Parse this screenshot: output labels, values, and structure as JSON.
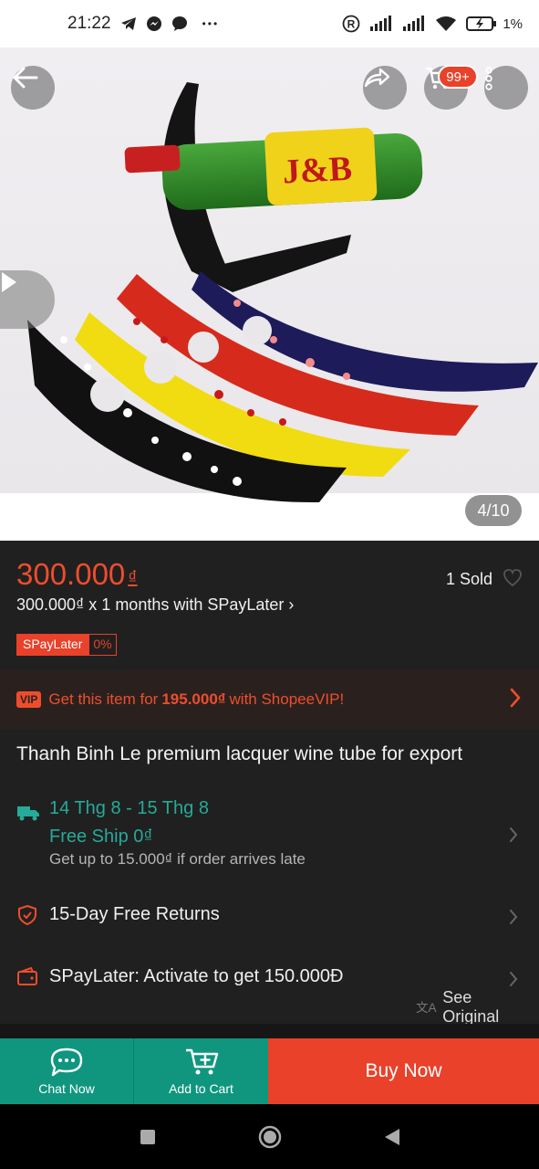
{
  "status_bar": {
    "time": "21:22",
    "more_dots": "•••",
    "battery_text": "1%"
  },
  "gallery": {
    "page_indicator": "4/10",
    "cart_badge": "99+"
  },
  "product": {
    "price": "300.000",
    "currency": "₫",
    "sold": "1 Sold",
    "installment": "300.000₫ x 1 months with SPayLater ›",
    "spay_badge_label": "SPayLater",
    "spay_badge_rate": "0%",
    "vip_tag": "VIP",
    "vip_text_prefix": "Get this item for",
    "vip_price": "195.000₫",
    "vip_text_suffix": "with ShopeeVIP!",
    "title": "Thanh Binh Le premium lacquer wine tube for export"
  },
  "shipping": {
    "dates": "14 Thg 8 - 15 Thg 8",
    "free_ship": "Free Ship 0₫",
    "late_note": "Get up to 15.000₫ if order arrives late"
  },
  "returns": {
    "label": "15-Day Free Returns"
  },
  "spaylater_promo": {
    "label": "SPayLater: Activate to get 150.000Đ"
  },
  "see_original": "See Original",
  "actions": {
    "chat_label": "Chat Now",
    "cart_label": "Add to Cart",
    "buy_label": "Buy Now"
  },
  "colors": {
    "accent": "#ee4d2d",
    "teal": "#26aa99",
    "action_teal": "#10967f"
  }
}
